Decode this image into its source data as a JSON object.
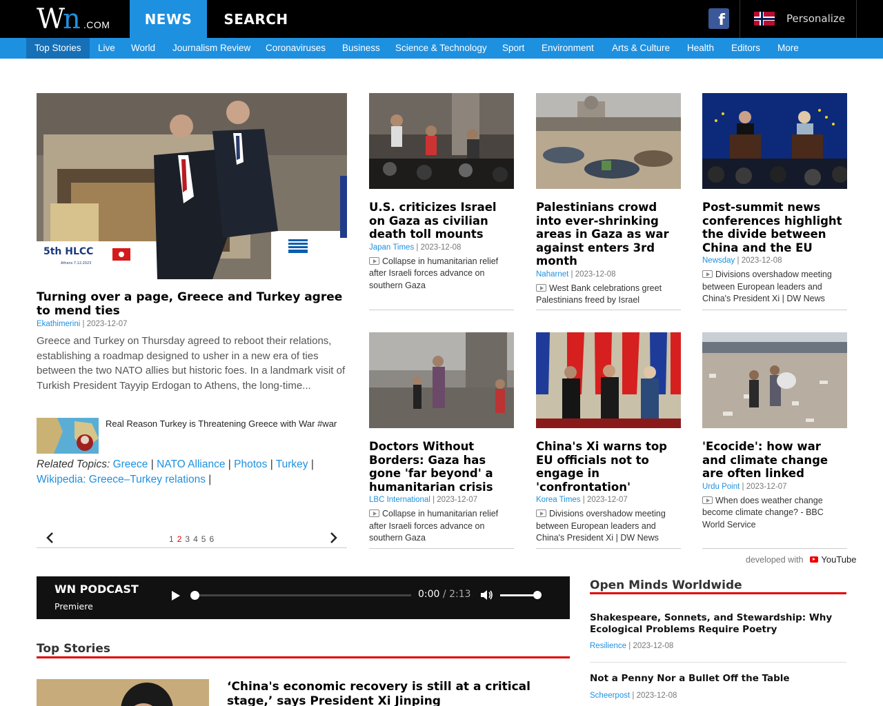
{
  "header": {
    "logo": {
      "w": "W",
      "n": "n",
      "com": ".COM"
    },
    "tabs": [
      "NEWS",
      "SEARCH"
    ],
    "facebook_glyph": "f",
    "personalize": "Personalize"
  },
  "nav": {
    "items": [
      "Top Stories",
      "Live",
      "World",
      "Journalism Review",
      "Coronaviruses",
      "Business",
      "Science & Technology",
      "Sport",
      "Environment",
      "Arts & Culture",
      "Health",
      "Editors",
      "More"
    ]
  },
  "hero": {
    "title": "Turning over a page, Greece and Turkey agree to mend ties",
    "source": "Ekathimerini",
    "date": "2023-12-07",
    "description": "Greece and Turkey on Thursday agreed to reboot their relations, establishing a roadmap designed to usher in a new era of ties between the two NATO allies but historic foes. In a landmark visit of Turkish President Tayyip Erdogan to Athens, the long-time...",
    "video_title": "Real Reason Turkey is Threatening Greece with War #war",
    "related_label": "Related Topics:",
    "related_topics": [
      "Greece",
      "NATO Alliance",
      "Photos",
      "Turkey",
      "Wikipedia: Greece–Turkey relations"
    ],
    "image_text": {
      "hlcc": "5th HLCC",
      "date_small": "Athens 7.12.2023"
    }
  },
  "pager": {
    "pages": [
      "1",
      "2",
      "3",
      "4",
      "5",
      "6"
    ],
    "current": "2"
  },
  "cards": [
    {
      "title": "U.S. criticizes Israel on Gaza as civilian death toll mounts",
      "source": "Japan Times",
      "date": "2023-12-08",
      "video": "Collapse in humanitarian relief after Israeli forces advance on southern Gaza"
    },
    {
      "title": "Palestinians crowd into ever-shrinking areas in Gaza as war against enters 3rd month",
      "source": "Naharnet",
      "date": "2023-12-08",
      "video": "West Bank celebrations greet Palestinians freed by Israel"
    },
    {
      "title": "Post-summit news conferences highlight the divide between China and the EU",
      "source": "Newsday",
      "date": "2023-12-08",
      "video": "Divisions overshadow meeting between European leaders and China's President Xi | DW News"
    },
    {
      "title": "Doctors Without Borders: Gaza has gone 'far beyond' a humanitarian crisis",
      "source": "LBC International",
      "date": "2023-12-07",
      "video": "Collapse in humanitarian relief after Israeli forces advance on southern Gaza"
    },
    {
      "title": "China's Xi warns top EU officials not to engage in 'confrontation'",
      "source": "Korea Times",
      "date": "2023-12-07",
      "video": "Divisions overshadow meeting between European leaders and China's President Xi | DW News"
    },
    {
      "title": "'Ecocide': how war and climate change are often linked",
      "source": "Urdu Point",
      "date": "2023-12-07",
      "video": "When does weather change become climate change? - BBC World Service"
    }
  ],
  "developed": {
    "label": "developed with",
    "brand": "YouTube"
  },
  "podcast": {
    "title": "WN PODCAST",
    "subtitle": "Premiere",
    "current": "0:00",
    "separator": "/",
    "total": "2:13"
  },
  "top_stories": {
    "heading": "Top Stories",
    "first_title": "‘China's economic recovery is still at a critical stage,’ says President Xi Jinping"
  },
  "open_minds": {
    "heading": "Open Minds Worldwide",
    "items": [
      {
        "title": "Shakespeare, Sonnets, and Stewardship: Why Ecological Problems Require Poetry",
        "source": "Resilience",
        "date": "2023-12-08"
      },
      {
        "title": "Not a Penny Nor a Bullet Off the Table",
        "source": "Scheerpost",
        "date": "2023-12-08"
      }
    ]
  },
  "meta_separator": "|",
  "colors": {
    "accent": "#1e90e0",
    "nav_active": "#1570b8",
    "section_rule": "#dd0000",
    "topbar": "#000000"
  }
}
